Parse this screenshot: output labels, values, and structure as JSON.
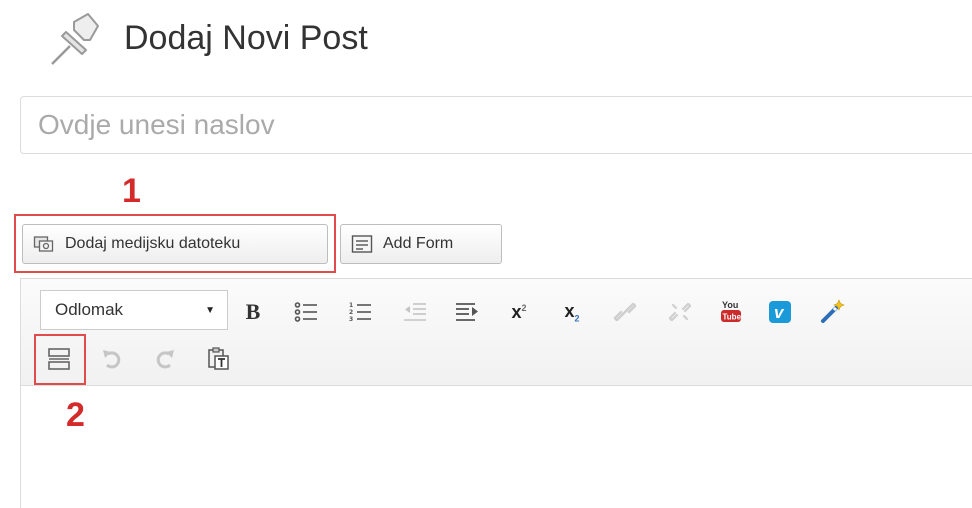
{
  "header": {
    "title": "Dodaj Novi Post",
    "icon": "pushpin-icon"
  },
  "title_field": {
    "placeholder": "Ovdje unesi naslov",
    "value": ""
  },
  "media_buttons": {
    "add_media_label": "Dodaj medijsku datoteku",
    "add_form_label": "Add Form"
  },
  "annotations": {
    "one": "1",
    "two": "2",
    "color": "#d42a2a"
  },
  "editor": {
    "format_selected": "Odlomak",
    "bold_label": "B",
    "superscript_base": "x",
    "superscript_mark": "2",
    "subscript_base": "x",
    "subscript_mark": "2",
    "youtube_top": "You",
    "youtube_bottom": "Tube",
    "vimeo_letter": "v",
    "toolbar_row1_icons": [
      "bold-icon",
      "bullet-list-icon",
      "numbered-list-icon",
      "outdent-icon",
      "align-icon",
      "superscript-icon",
      "subscript-icon",
      "link-icon",
      "unlink-icon",
      "youtube-icon",
      "vimeo-icon",
      "magic-wand-icon"
    ],
    "toolbar_row2_icons": [
      "toolbar-toggle-icon",
      "undo-icon",
      "redo-icon",
      "paste-text-icon"
    ],
    "content": ""
  }
}
